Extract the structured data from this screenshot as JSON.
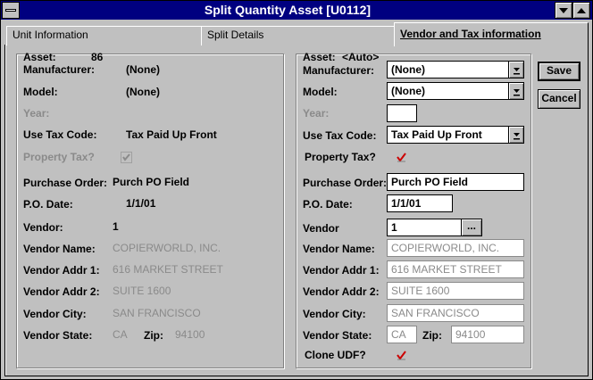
{
  "window": {
    "title": "Split Quantity Asset [U0112]"
  },
  "tabs": [
    {
      "label": "Unit Information"
    },
    {
      "label": "Split Details"
    },
    {
      "label": "Vendor and Tax information"
    }
  ],
  "left": {
    "asset_label": "Asset:",
    "asset_value": "86",
    "manufacturer_label": "Manufacturer:",
    "manufacturer_value": "(None)",
    "model_label": "Model:",
    "model_value": "(None)",
    "year_label": "Year:",
    "use_tax_label": "Use Tax Code:",
    "use_tax_value": "Tax Paid Up Front",
    "property_tax_label": "Property Tax?",
    "po_label": "Purchase Order:",
    "po_value": "Purch PO Field",
    "po_date_label": "P.O. Date:",
    "po_date_value": "1/1/01",
    "vendor_label": "Vendor:",
    "vendor_value": "1",
    "vendor_name_label": "Vendor Name:",
    "vendor_name_value": "COPIERWORLD, INC.",
    "addr1_label": "Vendor Addr 1:",
    "addr1_value": "616 MARKET STREET",
    "addr2_label": "Vendor Addr 2:",
    "addr2_value": "SUITE 1600",
    "city_label": "Vendor City:",
    "city_value": "SAN FRANCISCO",
    "state_label": "Vendor State:",
    "state_value": "CA",
    "zip_label": "Zip:",
    "zip_value": "94100"
  },
  "right": {
    "asset_label": "Asset:",
    "asset_value": "<Auto>",
    "manufacturer_label": "Manufacturer:",
    "manufacturer_value": "(None)",
    "model_label": "Model:",
    "model_value": "(None)",
    "year_label": "Year:",
    "year_value": "",
    "use_tax_label": "Use Tax Code:",
    "use_tax_value": "Tax Paid Up Front",
    "property_tax_label": "Property Tax?",
    "po_label": "Purchase Order:",
    "po_value": "Purch PO Field",
    "po_date_label": "P.O. Date:",
    "po_date_value": "1/1/01",
    "vendor_label": "Vendor",
    "vendor_value": "1",
    "vendor_lookup": "...",
    "vendor_name_label": "Vendor Name:",
    "vendor_name_value": "COPIERWORLD, INC.",
    "addr1_label": "Vendor Addr 1:",
    "addr1_value": "616 MARKET STREET",
    "addr2_label": "Vendor Addr 2:",
    "addr2_value": "SUITE 1600",
    "city_label": "Vendor City:",
    "city_value": "SAN FRANCISCO",
    "state_label": "Vendor State:",
    "state_value": "CA",
    "zip_label": "Zip:",
    "zip_value": "94100",
    "clone_udf_label": "Clone UDF?"
  },
  "buttons": {
    "save": "Save",
    "cancel": "Cancel"
  },
  "colors": {
    "titlebar": "#000080",
    "face": "#c0c0c0",
    "disabled_text": "#8a8a8a",
    "check_red": "#cc0000"
  }
}
